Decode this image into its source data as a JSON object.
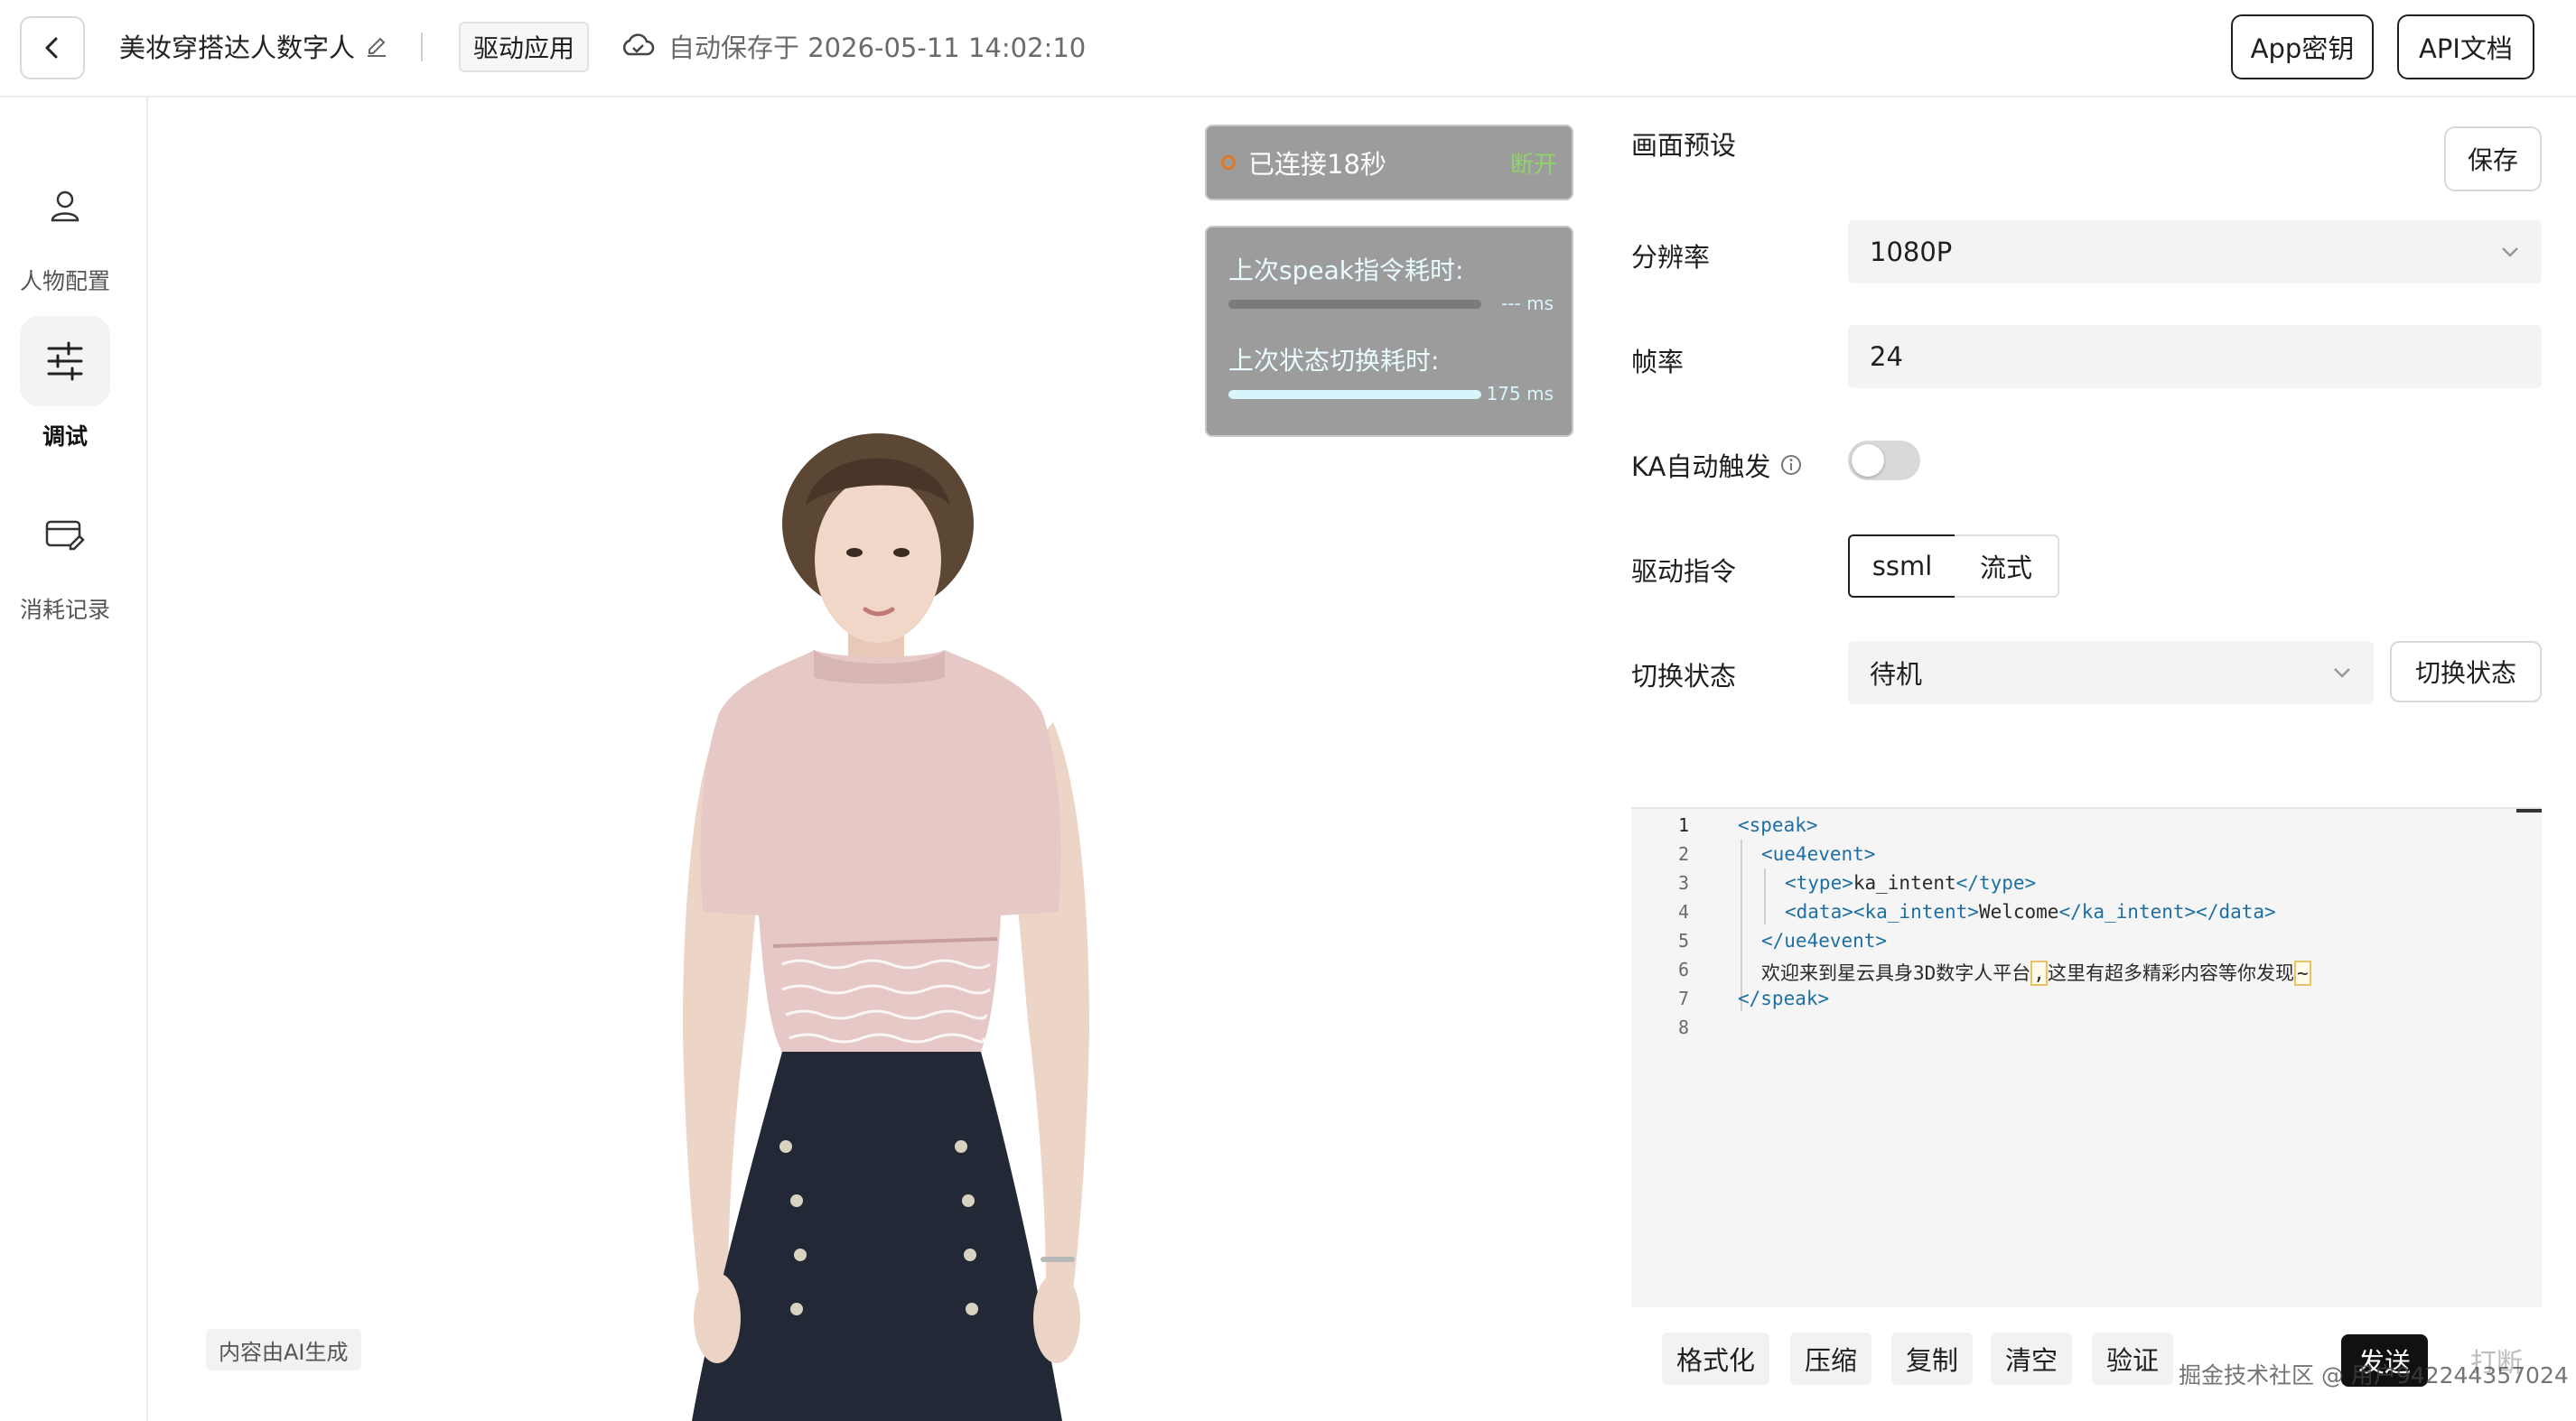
{
  "header": {
    "title": "美妆穿搭达人数字人",
    "tag": "驱动应用",
    "autosave": "自动保存于 2026-05-11 14:02:10",
    "appkey_label": "App密钥",
    "apidoc_label": "API文档"
  },
  "sidebar": {
    "items": [
      {
        "label": "人物配置",
        "icon": "person-icon",
        "active": false
      },
      {
        "label": "调试",
        "icon": "sliders-icon",
        "active": true
      },
      {
        "label": "消耗记录",
        "icon": "card-edit-icon",
        "active": false
      }
    ]
  },
  "stage": {
    "ai_label": "内容由AI生成",
    "connection": {
      "text": "已连接18秒",
      "action": "断开",
      "dot_color": "#e07a22"
    },
    "latency": {
      "speak_label": "上次speak指令耗时:",
      "speak_value": "--- ms",
      "speak_progress": 0,
      "state_label": "上次状态切换耗时:",
      "state_value": "175 ms",
      "state_progress": 1.0
    }
  },
  "panel": {
    "preset_label": "画面预设",
    "save_label": "保存",
    "resolution_label": "分辨率",
    "resolution_value": "1080P",
    "fps_label": "帧率",
    "fps_value": "24",
    "ka_label": "KA自动触发",
    "ka_enabled": false,
    "command_label": "驱动指令",
    "command_options": [
      "ssml",
      "流式"
    ],
    "command_selected": "ssml",
    "state_label": "切换状态",
    "state_value": "待机",
    "state_button": "切换状态"
  },
  "editor": {
    "lines": [
      "1",
      "2",
      "3",
      "4",
      "5",
      "6",
      "7",
      "8"
    ],
    "code": {
      "l1": "<speak>",
      "l2": "<ue4event>",
      "l3_open": "<type>",
      "l3_text": "ka_intent",
      "l3_close": "</type>",
      "l4_open": "<data><ka_intent>",
      "l4_text": "Welcome",
      "l4_close": "</ka_intent></data>",
      "l5": "</ue4event>",
      "l6_a": "欢迎来到星云具身3D数字人平台",
      "l6_comma": ",",
      "l6_b": "这里有超多精彩内容等你发现",
      "l6_tilde": "~",
      "l7": "</speak>"
    }
  },
  "toolbar": {
    "format": "格式化",
    "compress": "压缩",
    "copy": "复制",
    "clear": "清空",
    "validate": "验证",
    "send": "发送",
    "interrupt": "打断"
  },
  "watermark": "掘金技术社区 @ 用户942244357024",
  "colors": {
    "accent": "#111111",
    "connected_dot": "#e07a22",
    "disconnect": "#8fd46a",
    "progress": "#d8f5fb"
  }
}
